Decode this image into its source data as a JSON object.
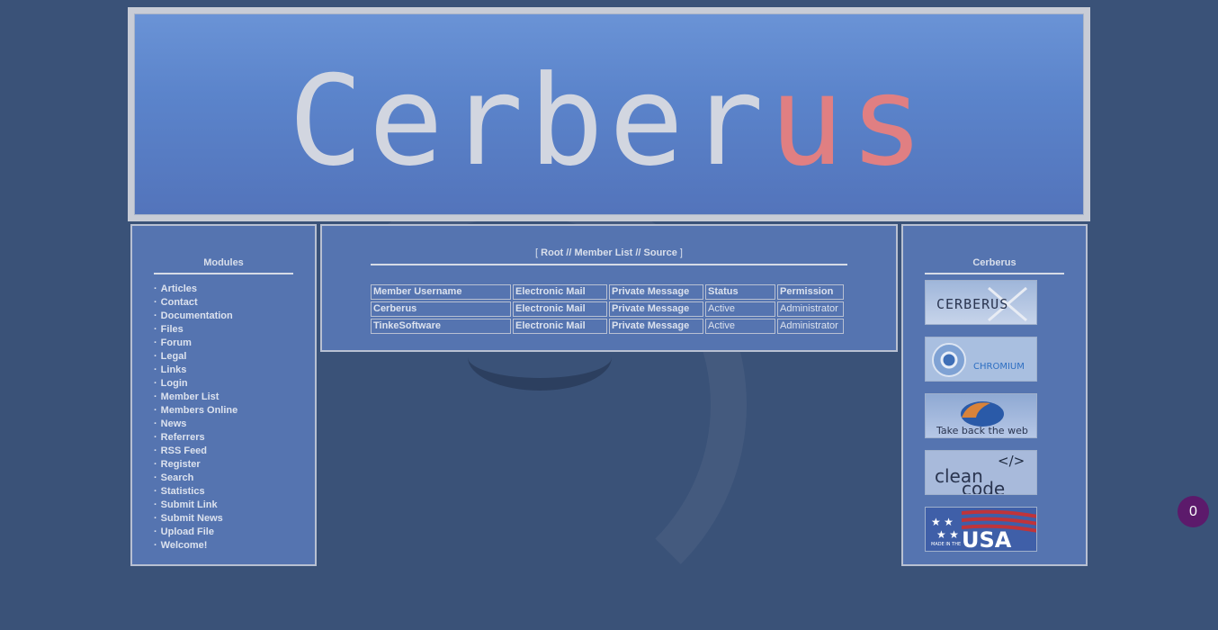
{
  "banner": {
    "logo_main": "Cerber",
    "logo_accent": "us"
  },
  "modules": {
    "title": "Modules",
    "items": [
      {
        "label": "Articles"
      },
      {
        "label": "Contact"
      },
      {
        "label": "Documentation"
      },
      {
        "label": "Files"
      },
      {
        "label": "Forum"
      },
      {
        "label": "Legal"
      },
      {
        "label": "Links"
      },
      {
        "label": "Login"
      },
      {
        "label": "Member List"
      },
      {
        "label": "Members Online"
      },
      {
        "label": "News"
      },
      {
        "label": "Referrers"
      },
      {
        "label": "RSS Feed"
      },
      {
        "label": "Register"
      },
      {
        "label": "Search"
      },
      {
        "label": "Statistics"
      },
      {
        "label": "Submit Link"
      },
      {
        "label": "Submit News"
      },
      {
        "label": "Upload File"
      },
      {
        "label": "Welcome!"
      }
    ]
  },
  "breadcrumb": {
    "open": "[",
    "root": "Root",
    "sep1": "//",
    "member_list": "Member List",
    "sep2": "//",
    "source": "Source",
    "close": "]"
  },
  "members_table": {
    "headers": [
      "Member Username",
      "Electronic Mail",
      "Private Message",
      "Status",
      "Permission"
    ],
    "rows": [
      [
        "Cerberus",
        "Electronic Mail",
        "Private Message",
        "Active",
        "Administrator"
      ],
      [
        "TinkeSoftware",
        "Electronic Mail",
        "Private Message",
        "Active",
        "Administrator"
      ]
    ]
  },
  "sidebar_right": {
    "title": "Cerberus",
    "badges": {
      "cerberus": "CERBERUS",
      "chromium": "CHROMIUM",
      "firefox": "Take back the web",
      "cleancode_1": "clean",
      "cleancode_2": "code",
      "cleancode_tag": "</>",
      "usa_small": "MADE IN THE",
      "usa_big": "USA"
    }
  },
  "notification": {
    "count": "0"
  },
  "colors": {
    "background": "#3a5278",
    "panel": "#5574b0",
    "border": "#b8c0d2",
    "logo_accent": "#e07f82",
    "notification": "#5c1a6b"
  }
}
